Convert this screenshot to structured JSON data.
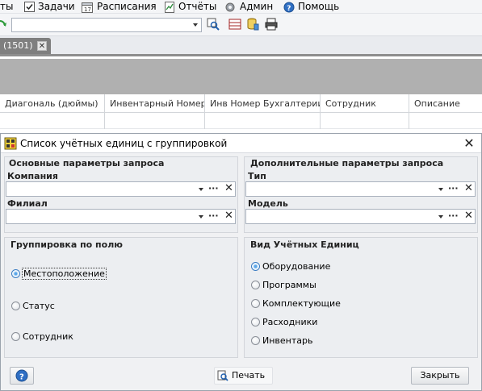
{
  "menu": {
    "items": [
      {
        "label": "ты"
      },
      {
        "label": "Задачи",
        "icon": "checkbox-icon"
      },
      {
        "label": "Расписания",
        "icon": "calendar-icon"
      },
      {
        "label": "Отчёты",
        "icon": "report-icon"
      },
      {
        "label": "Админ",
        "icon": "gear-icon"
      },
      {
        "label": "Помощь",
        "icon": "help-icon"
      }
    ]
  },
  "tab": {
    "label": "(1501)",
    "close": "✕"
  },
  "grid": {
    "columns": [
      "Диагональ (дюймы)",
      "Инвентарный Номер",
      "Инв Номер Бухгалтерии",
      "Сотрудник",
      "Описание"
    ]
  },
  "dialog": {
    "title": "Список учётных единиц с группировкой",
    "close": "✕",
    "main_params": {
      "title": "Основные параметры запроса",
      "company_label": "Компания",
      "branch_label": "Филиал"
    },
    "extra_params": {
      "title": "Дополнительные параметры запроса",
      "type_label": "Тип",
      "model_label": "Модель"
    },
    "grouping": {
      "title": "Группировка по полю",
      "options": [
        "Местоположение",
        "Статус",
        "Сотрудник"
      ],
      "selected": 0
    },
    "unit_kind": {
      "title": "Вид Учётных Единиц",
      "options": [
        "Оборудование",
        "Программы",
        "Комплектующие",
        "Расходники",
        "Инвентарь"
      ],
      "selected": 0
    },
    "picker_dots": "···",
    "picker_clear": "✕",
    "print_label": "Печать",
    "close_label": "Закрыть"
  }
}
